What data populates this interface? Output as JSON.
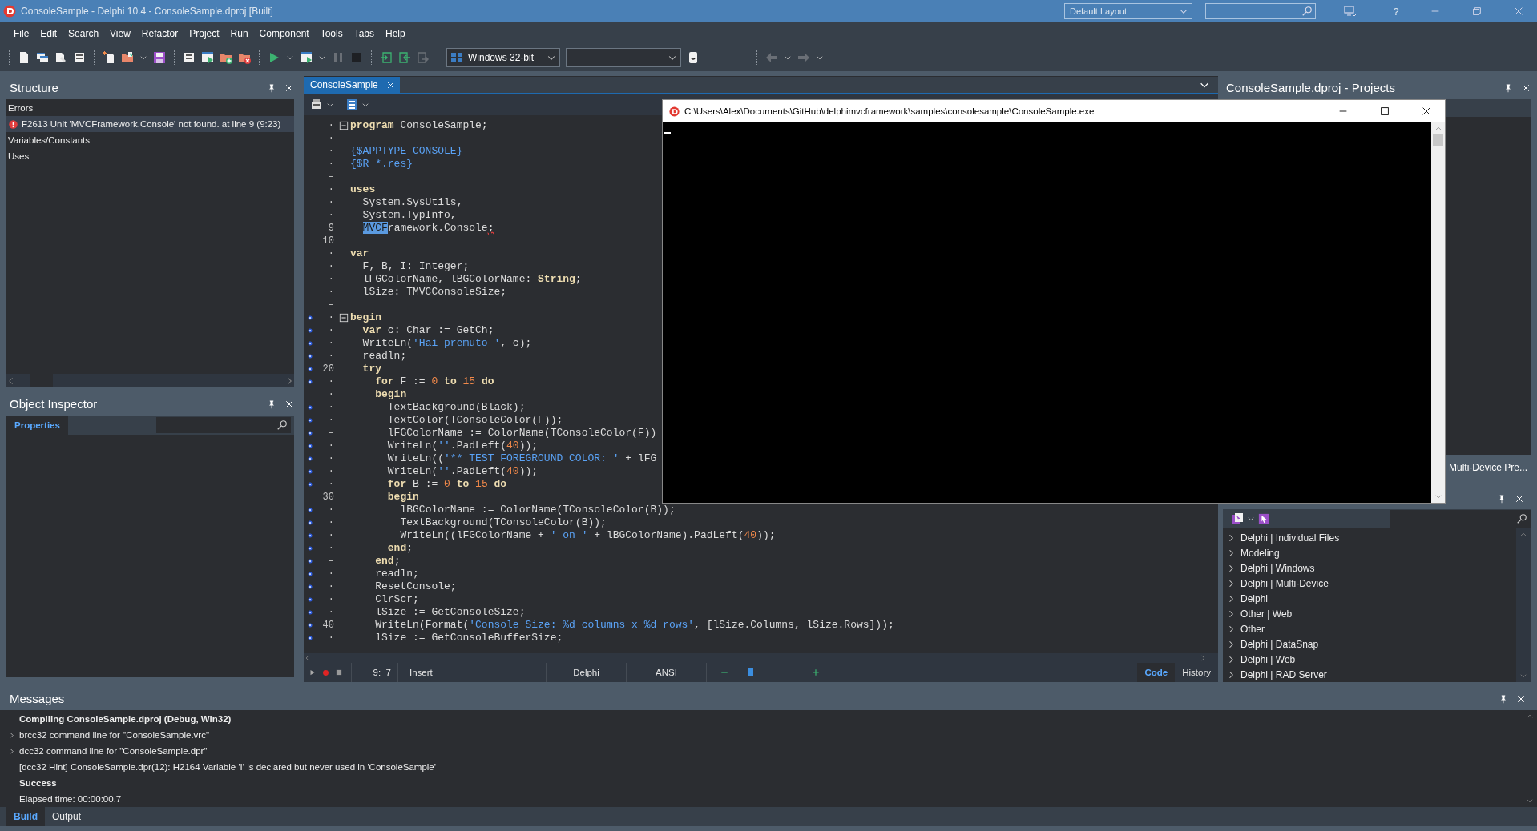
{
  "window": {
    "title": "ConsoleSample - Delphi 10.4 - ConsoleSample.dproj [Built]",
    "layout": "Default Layout",
    "help": "?"
  },
  "menu": [
    {
      "label": "File"
    },
    {
      "label": "Edit"
    },
    {
      "label": "Search"
    },
    {
      "label": "View"
    },
    {
      "label": "Refactor"
    },
    {
      "label": "Project"
    },
    {
      "label": "Run"
    },
    {
      "label": "Component"
    },
    {
      "label": "Tools"
    },
    {
      "label": "Tabs"
    },
    {
      "label": "Help"
    }
  ],
  "toolbar": {
    "platform": "Windows 32-bit"
  },
  "structure": {
    "title": "Structure",
    "items": [
      {
        "label": "Errors",
        "kind": "group",
        "selected": false
      },
      {
        "label": "F2613 Unit 'MVCFramework.Console' not found. at line 9 (9:23)",
        "kind": "error",
        "selected": true
      },
      {
        "label": "Variables/Constants",
        "kind": "group",
        "selected": false
      },
      {
        "label": "Uses",
        "kind": "group",
        "selected": false
      }
    ]
  },
  "object_inspector": {
    "title": "Object Inspector",
    "tabs": [
      {
        "label": "Properties",
        "selected": true
      }
    ]
  },
  "editor": {
    "tabs": [
      {
        "label": "ConsoleSample",
        "selected": true
      }
    ],
    "lines": [
      {
        "gutter": "·",
        "marker": false,
        "fold": true,
        "tokens": [
          {
            "kind": "kw",
            "text": "program"
          },
          {
            "kind": "p",
            "text": " ConsoleSample;"
          }
        ]
      },
      {
        "gutter": "·",
        "marker": false,
        "fold": false
      },
      {
        "gutter": "·",
        "marker": false,
        "fold": false,
        "tokens": [
          {
            "kind": "dir",
            "text": "{$APPTYPE CONSOLE}"
          }
        ]
      },
      {
        "gutter": "·",
        "marker": false,
        "fold": false,
        "tokens": [
          {
            "kind": "dir",
            "text": "{$R *.res}"
          }
        ]
      },
      {
        "gutter": "–",
        "marker": false,
        "fold": false
      },
      {
        "gutter": "·",
        "marker": false,
        "fold": false,
        "tokens": [
          {
            "kind": "kw",
            "text": "uses"
          }
        ]
      },
      {
        "gutter": "·",
        "marker": false,
        "fold": false,
        "tokens": [
          {
            "kind": "p",
            "text": "  System.SysUtils,"
          }
        ]
      },
      {
        "gutter": "·",
        "marker": false,
        "fold": false,
        "tokens": [
          {
            "kind": "p",
            "text": "  System.TypInfo,"
          }
        ]
      },
      {
        "gutter": "9",
        "marker": false,
        "fold": false,
        "tokens": [
          {
            "kind": "sel",
            "text": "  MVCF"
          },
          {
            "kind": "p",
            "text": "ramework.Console"
          },
          {
            "kind": "err",
            "text": ";"
          }
        ]
      },
      {
        "gutter": "10",
        "marker": false,
        "fold": false
      },
      {
        "gutter": "·",
        "marker": false,
        "fold": false,
        "tokens": [
          {
            "kind": "kw",
            "text": "var"
          }
        ]
      },
      {
        "gutter": "·",
        "marker": false,
        "fold": false,
        "tokens": [
          {
            "kind": "p",
            "text": "  F, B, I: Integer;"
          }
        ]
      },
      {
        "gutter": "·",
        "marker": false,
        "fold": false,
        "tokens": [
          {
            "kind": "p",
            "text": "  lFGColorName, lBGColorName: "
          },
          {
            "kind": "kw",
            "text": "String"
          },
          {
            "kind": "p",
            "text": ";"
          }
        ]
      },
      {
        "gutter": "·",
        "marker": false,
        "fold": false,
        "tokens": [
          {
            "kind": "p",
            "text": "  lSize: TMVCConsoleSize;"
          }
        ]
      },
      {
        "gutter": "–",
        "marker": false,
        "fold": false
      },
      {
        "gutter": "·",
        "marker": true,
        "fold": true,
        "tokens": [
          {
            "kind": "kw",
            "text": "begin"
          }
        ]
      },
      {
        "gutter": "·",
        "marker": true,
        "fold": false,
        "tokens": [
          {
            "kind": "kw",
            "text": "  var"
          },
          {
            "kind": "p",
            "text": " c: Char := GetCh;"
          }
        ]
      },
      {
        "gutter": "·",
        "marker": true,
        "fold": false,
        "tokens": [
          {
            "kind": "p",
            "text": "  WriteLn("
          },
          {
            "kind": "str",
            "text": "'Hai premuto '"
          },
          {
            "kind": "p",
            "text": ", c);"
          }
        ]
      },
      {
        "gutter": "·",
        "marker": true,
        "fold": false,
        "tokens": [
          {
            "kind": "p",
            "text": "  readln;"
          }
        ]
      },
      {
        "gutter": "20",
        "marker": true,
        "fold": false,
        "tokens": [
          {
            "kind": "kw",
            "text": "  try"
          }
        ]
      },
      {
        "gutter": "·",
        "marker": true,
        "fold": false,
        "tokens": [
          {
            "kind": "kw",
            "text": "    for"
          },
          {
            "kind": "p",
            "text": " F := "
          },
          {
            "kind": "num",
            "text": "0"
          },
          {
            "kind": "kw",
            "text": " to "
          },
          {
            "kind": "num",
            "text": "15"
          },
          {
            "kind": "kw",
            "text": " do"
          }
        ]
      },
      {
        "gutter": "·",
        "marker": false,
        "fold": false,
        "tokens": [
          {
            "kind": "kw",
            "text": "    begin"
          }
        ]
      },
      {
        "gutter": "·",
        "marker": true,
        "fold": false,
        "tokens": [
          {
            "kind": "p",
            "text": "      TextBackground(Black);"
          }
        ]
      },
      {
        "gutter": "·",
        "marker": true,
        "fold": false,
        "tokens": [
          {
            "kind": "p",
            "text": "      TextColor(TConsoleColor(F));"
          }
        ]
      },
      {
        "gutter": "–",
        "marker": true,
        "fold": false,
        "tokens": [
          {
            "kind": "p",
            "text": "      lFGColorName := ColorName(TConsoleColor(F))"
          }
        ]
      },
      {
        "gutter": "·",
        "marker": true,
        "fold": false,
        "tokens": [
          {
            "kind": "p",
            "text": "      WriteLn("
          },
          {
            "kind": "str",
            "text": "''"
          },
          {
            "kind": "p",
            "text": ".PadLeft("
          },
          {
            "kind": "num",
            "text": "40"
          },
          {
            "kind": "p",
            "text": "));"
          }
        ]
      },
      {
        "gutter": "·",
        "marker": true,
        "fold": false,
        "tokens": [
          {
            "kind": "p",
            "text": "      WriteLn(("
          },
          {
            "kind": "str",
            "text": "'** TEST FOREGROUND COLOR: '"
          },
          {
            "kind": "p",
            "text": " + lFG"
          }
        ]
      },
      {
        "gutter": "·",
        "marker": true,
        "fold": false,
        "tokens": [
          {
            "kind": "p",
            "text": "      WriteLn("
          },
          {
            "kind": "str",
            "text": "''"
          },
          {
            "kind": "p",
            "text": ".PadLeft("
          },
          {
            "kind": "num",
            "text": "40"
          },
          {
            "kind": "p",
            "text": "));"
          }
        ]
      },
      {
        "gutter": "·",
        "marker": true,
        "fold": false,
        "tokens": [
          {
            "kind": "kw",
            "text": "      for"
          },
          {
            "kind": "p",
            "text": " B := "
          },
          {
            "kind": "num",
            "text": "0"
          },
          {
            "kind": "kw",
            "text": " to "
          },
          {
            "kind": "num",
            "text": "15"
          },
          {
            "kind": "kw",
            "text": " do"
          }
        ]
      },
      {
        "gutter": "30",
        "marker": false,
        "fold": false,
        "tokens": [
          {
            "kind": "kw",
            "text": "      begin"
          }
        ]
      },
      {
        "gutter": "·",
        "marker": true,
        "fold": false,
        "tokens": [
          {
            "kind": "p",
            "text": "        lBGColorName := ColorName(TConsoleColor(B));"
          }
        ]
      },
      {
        "gutter": "·",
        "marker": true,
        "fold": false,
        "tokens": [
          {
            "kind": "p",
            "text": "        TextBackground(TConsoleColor(B));"
          }
        ]
      },
      {
        "gutter": "·",
        "marker": true,
        "fold": false,
        "tokens": [
          {
            "kind": "p",
            "text": "        WriteLn((lFGColorName + "
          },
          {
            "kind": "str",
            "text": "' on '"
          },
          {
            "kind": "p",
            "text": " + lBGColorName).PadLeft("
          },
          {
            "kind": "num",
            "text": "40"
          },
          {
            "kind": "p",
            "text": "));"
          }
        ]
      },
      {
        "gutter": "·",
        "marker": true,
        "fold": false,
        "tokens": [
          {
            "kind": "kw",
            "text": "      end"
          },
          {
            "kind": "p",
            "text": ";"
          }
        ]
      },
      {
        "gutter": "–",
        "marker": true,
        "fold": false,
        "tokens": [
          {
            "kind": "kw",
            "text": "    end"
          },
          {
            "kind": "p",
            "text": ";"
          }
        ]
      },
      {
        "gutter": "·",
        "marker": true,
        "fold": false,
        "tokens": [
          {
            "kind": "p",
            "text": "    readln;"
          }
        ]
      },
      {
        "gutter": "·",
        "marker": true,
        "fold": false,
        "tokens": [
          {
            "kind": "p",
            "text": "    ResetConsole;"
          }
        ]
      },
      {
        "gutter": "·",
        "marker": true,
        "fold": false,
        "tokens": [
          {
            "kind": "p",
            "text": "    ClrScr;"
          }
        ]
      },
      {
        "gutter": "·",
        "marker": true,
        "fold": false,
        "tokens": [
          {
            "kind": "p",
            "text": "    lSize := GetConsoleSize;"
          }
        ]
      },
      {
        "gutter": "40",
        "marker": true,
        "fold": false,
        "tokens": [
          {
            "kind": "p",
            "text": "    WriteLn(Format("
          },
          {
            "kind": "str",
            "text": "'Console Size: %d columns x %d rows'"
          },
          {
            "kind": "p",
            "text": ", [lSize.Columns, lSize.Rows]));"
          }
        ]
      },
      {
        "gutter": "·",
        "marker": true,
        "fold": false,
        "tokens": [
          {
            "kind": "p",
            "text": "    lSize := GetConsoleBufferSize;"
          }
        ]
      }
    ],
    "status": {
      "position": "9:  7",
      "mode": "Insert",
      "language": "Delphi",
      "encoding": "ANSI",
      "zoom": {
        "level": 0.2
      }
    },
    "view_tabs": [
      {
        "label": "Code",
        "selected": true
      },
      {
        "label": "History",
        "selected": false
      }
    ]
  },
  "console": {
    "title": "C:\\Users\\Alex\\Documents\\GitHub\\delphimvcframework\\samples\\consolesample\\ConsoleSample.exe"
  },
  "projects": {
    "title": "ConsoleSample.dproj - Projects",
    "tabs": [
      {
        "label": "Multi-Device Pre...",
        "selected": false
      }
    ]
  },
  "palette": {
    "items": [
      {
        "label": "Delphi | Individual Files",
        "expanded": false
      },
      {
        "label": "Modeling",
        "expanded": false
      },
      {
        "label": "Delphi | Windows",
        "expanded": false
      },
      {
        "label": "Delphi | Multi-Device",
        "expanded": false
      },
      {
        "label": "Delphi",
        "expanded": false
      },
      {
        "label": "Other | Web",
        "expanded": false
      },
      {
        "label": "Other",
        "expanded": false
      },
      {
        "label": "Delphi | DataSnap",
        "expanded": false
      },
      {
        "label": "Delphi | Web",
        "expanded": false
      },
      {
        "label": "Delphi | RAD Server",
        "expanded": false
      }
    ]
  },
  "messages": {
    "title": "Messages",
    "items": [
      {
        "text": "Compiling ConsoleSample.dproj (Debug, Win32)",
        "kind": "bold"
      },
      {
        "text": "brcc32 command line for \"ConsoleSample.vrc\"",
        "kind": "expandable"
      },
      {
        "text": "dcc32 command line for \"ConsoleSample.dpr\"",
        "kind": "expandable"
      },
      {
        "text": "[dcc32 Hint] ConsoleSample.dpr(12): H2164 Variable 'I' is declared but never used in 'ConsoleSample'",
        "kind": "plain"
      },
      {
        "text": "Success",
        "kind": "bold"
      },
      {
        "text": "Elapsed time: 00:00:00.7",
        "kind": "plain"
      }
    ],
    "tabs": [
      {
        "label": "Build",
        "selected": true
      },
      {
        "label": "Output",
        "selected": false
      }
    ]
  }
}
